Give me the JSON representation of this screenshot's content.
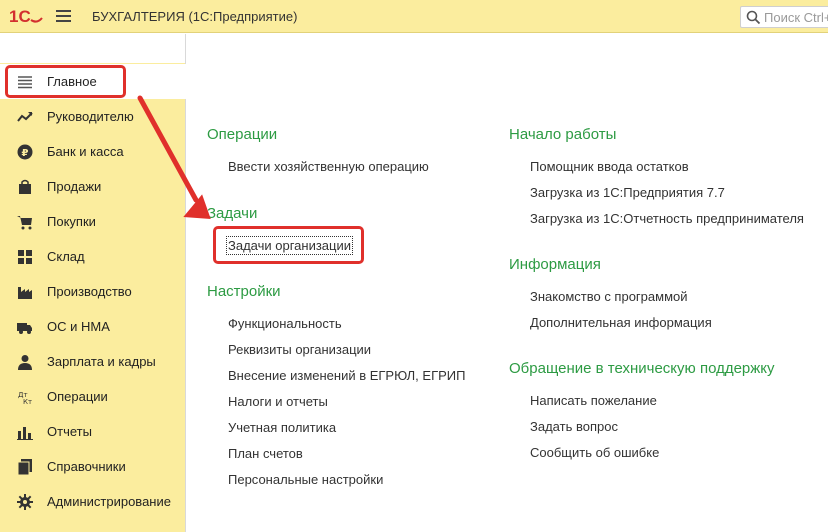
{
  "header": {
    "app_title": "БУХГАЛТЕРИЯ  (1С:Предприятие)",
    "search_placeholder": "Поиск Ctrl+"
  },
  "sidebar": {
    "items": [
      {
        "label": "Главное",
        "icon": "menu-lines-icon",
        "active": true
      },
      {
        "label": "Руководителю",
        "icon": "trend-up-icon"
      },
      {
        "label": "Банк и касса",
        "icon": "ruble-coin-icon"
      },
      {
        "label": "Продажи",
        "icon": "shopping-bag-icon"
      },
      {
        "label": "Покупки",
        "icon": "shopping-cart-icon"
      },
      {
        "label": "Склад",
        "icon": "warehouse-grid-icon"
      },
      {
        "label": "Производство",
        "icon": "factory-icon"
      },
      {
        "label": "ОС и НМА",
        "icon": "truck-icon"
      },
      {
        "label": "Зарплата и кадры",
        "icon": "person-icon"
      },
      {
        "label": "Операции",
        "icon": "debit-credit-icon"
      },
      {
        "label": "Отчеты",
        "icon": "bar-chart-icon"
      },
      {
        "label": "Справочники",
        "icon": "books-icon"
      },
      {
        "label": "Администрирование",
        "icon": "gear-icon"
      }
    ]
  },
  "main": {
    "left_column": [
      {
        "title": "Операции",
        "links": [
          "Ввести хозяйственную операцию"
        ]
      },
      {
        "title": "Задачи",
        "links": [
          "Задачи организации"
        ]
      },
      {
        "title": "Настройки",
        "links": [
          "Функциональность",
          "Реквизиты организации",
          "Внесение изменений в ЕГРЮЛ, ЕГРИП",
          "Налоги и отчеты",
          "Учетная политика",
          "План счетов",
          "Персональные настройки"
        ]
      }
    ],
    "right_column": [
      {
        "title": "Начало работы",
        "links": [
          "Помощник ввода остатков",
          "Загрузка из 1С:Предприятия 7.7",
          "Загрузка из 1С:Отчетность предпринимателя"
        ]
      },
      {
        "title": "Информация",
        "links": [
          "Знакомство с программой",
          "Дополнительная информация"
        ]
      },
      {
        "title": "Обращение в техническую поддержку",
        "links": [
          "Написать пожелание",
          "Задать вопрос",
          "Сообщить об ошибке"
        ]
      }
    ]
  },
  "colors": {
    "section_title": "#2d9b43",
    "panel_bg": "#fbed9e",
    "highlight": "#e0302b"
  }
}
